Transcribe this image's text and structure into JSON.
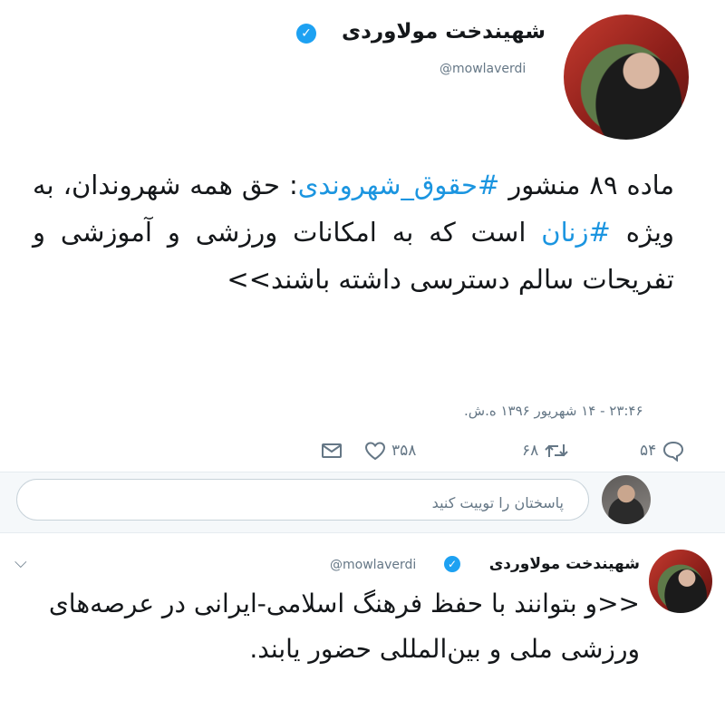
{
  "tweet": {
    "display_name": "شهیندخت مولاوردی",
    "handle": "@mowlaverdi",
    "text_part1": "ماده ۸۹ منشور ",
    "hashtag1": "#حقوق_شهروندی",
    "text_part2": ": حق همه شهروندان، به ویژه ",
    "hashtag2": "#زنان",
    "text_part3": " است که به امکانات ورزشی و آموزشی و تفریحات سالم دسترسی داشته باشند>>",
    "timestamp": "۲۳:۴۶ - ۱۴ شهریور ۱۳۹۶ ه.ش.",
    "reply_count": "۵۴",
    "retweet_count": "۶۸",
    "like_count": "۳۵۸"
  },
  "reply": {
    "placeholder": "پاسختان را توییت کنید"
  },
  "thread_reply": {
    "display_name": "شهیندخت مولاوردی",
    "handle": "@mowlaverdi",
    "text": "<<و بتوانند با حفظ فرهنگ اسلامی-ایرانی در عرصه‌های ورزشی ملی و بین‌المللی حضور یابند."
  },
  "colors": {
    "accent": "#1b95e0",
    "verified": "#1da1f2",
    "muted": "#657786"
  }
}
